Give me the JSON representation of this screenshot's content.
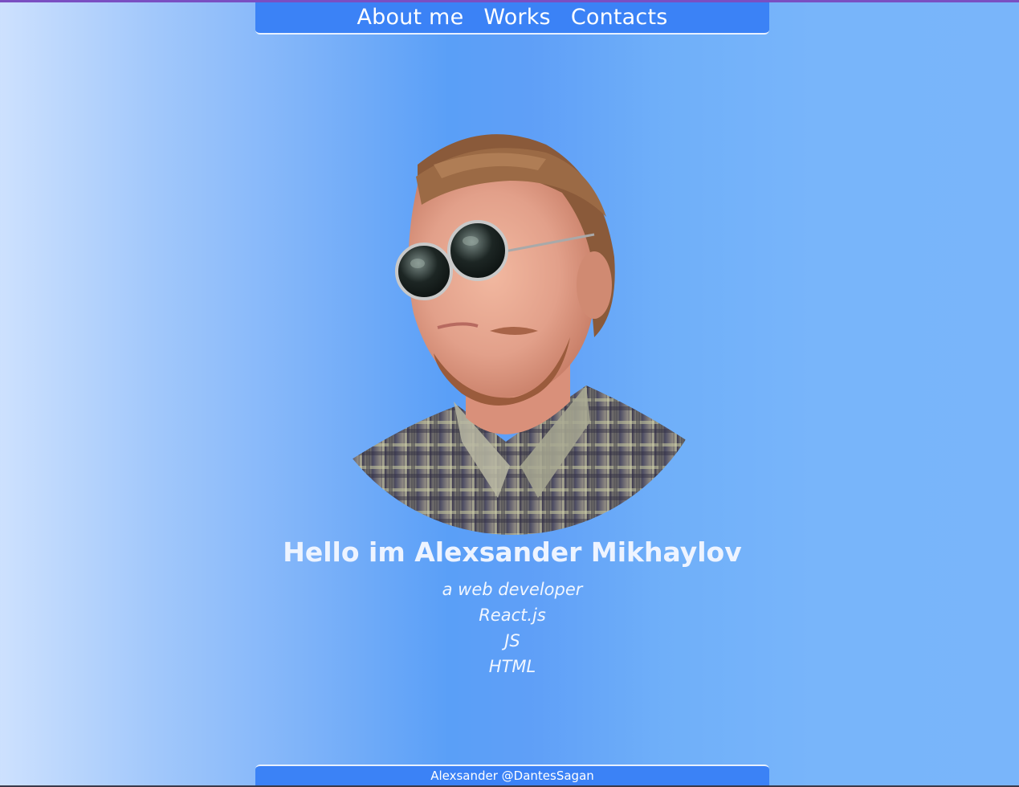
{
  "nav": {
    "links": [
      "About me",
      "Works",
      "Contacts"
    ]
  },
  "hero": {
    "portrait_alt": "portrait",
    "heading": "Hello im Alexsander Mikhaylov",
    "skills": [
      "a web developer",
      "React.js",
      "JS",
      "HTML"
    ]
  },
  "footer": {
    "text": "Alexsander @DantesSagan"
  },
  "colors": {
    "nav_bg": "#3b82f6",
    "page_gradient_start": "#cde1fe",
    "page_gradient_mid": "#5a9ff7",
    "page_gradient_end": "#79b5fa",
    "top_rule": "#7a4fc2"
  }
}
